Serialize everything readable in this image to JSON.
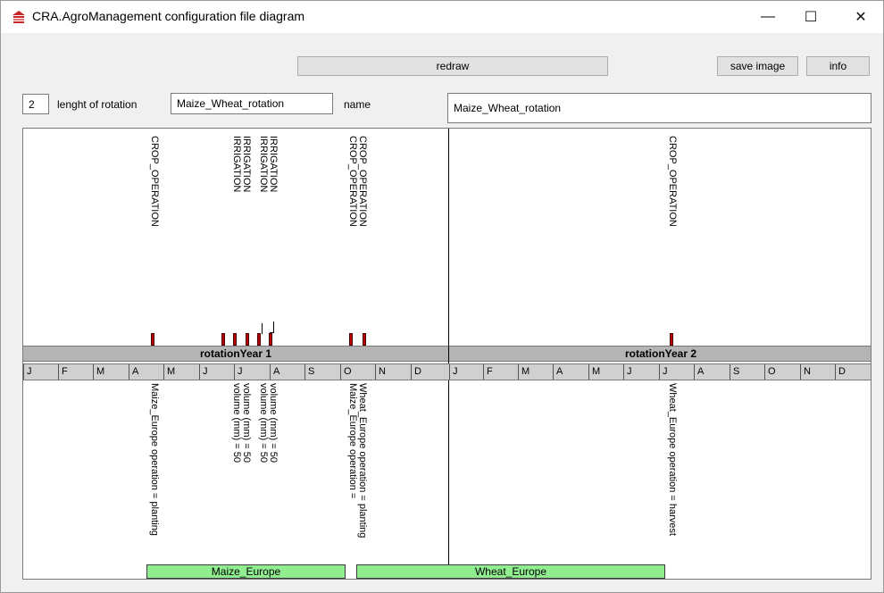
{
  "window": {
    "title": "CRA.AgroManagement configuration file diagram",
    "controls": {
      "minimize": "—",
      "maximize": "☐",
      "close": "✕"
    }
  },
  "toolbar": {
    "redraw_label": "redraw",
    "save_image_label": "save image",
    "info_label": "info"
  },
  "rotation": {
    "length_value": "2",
    "length_label": "lenght of rotation",
    "name_field_value": "Maize_Wheat_rotation",
    "name_label": "name",
    "name_display_value": "Maize_Wheat_rotation"
  },
  "diagram": {
    "years": [
      "rotationYear 1",
      "rotationYear 2"
    ],
    "months": [
      "J",
      "F",
      "M",
      "A",
      "M",
      "J",
      "J",
      "A",
      "S",
      "O",
      "N",
      "D",
      "J",
      "F",
      "M",
      "A",
      "M",
      "J",
      "J",
      "A",
      "S",
      "O",
      "N",
      "D"
    ],
    "top_labels": {
      "crop_operation": "CROP_OPERATION",
      "irrigation": "IRRIGATION"
    },
    "bottom_labels": {
      "maize_planting": "Maize_Europe operation = planting",
      "volume": "volume (mm) = 50",
      "wheat_planting": "Wheat_Europe operation = planting",
      "maize_harvest": "Maize_Europe operation = ",
      "wheat_harvest": "Wheat_Europe operation = harvest"
    },
    "crops": [
      "Maize_Europe",
      "Wheat_Europe"
    ],
    "colors": {
      "marker": "#c00000",
      "crop_bar": "#90ee90",
      "band": "#b4b4b4"
    }
  }
}
